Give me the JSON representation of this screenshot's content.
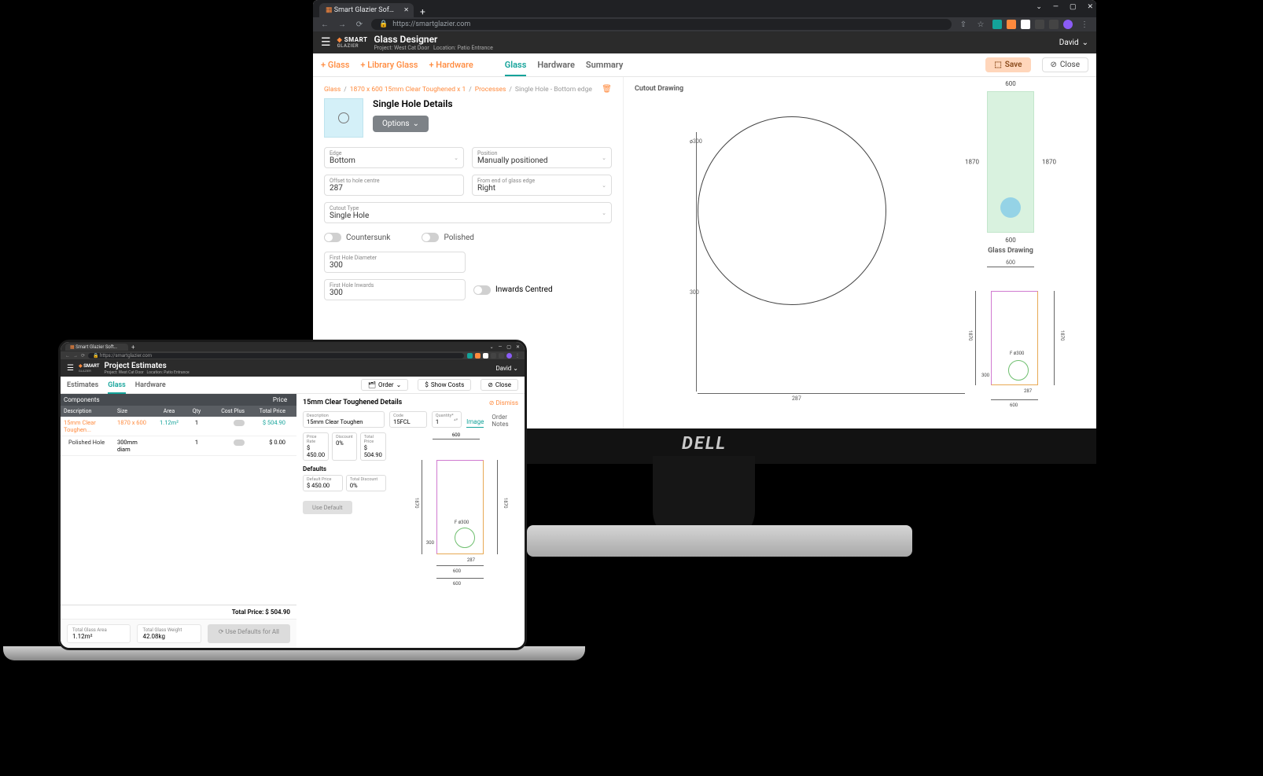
{
  "monitor": {
    "browser_tab": "Smart Glazier Software",
    "url": "https://smartglazier.com",
    "logo_a": "SMART",
    "logo_b": "GLAZIER",
    "title": "Glass Designer",
    "sub_project_lbl": "Project:",
    "sub_project": "West Cat Door",
    "sub_loc_lbl": "Location:",
    "sub_loc": "Patio Entrance",
    "user": "David",
    "toolbar": {
      "add_glass": "+ Glass",
      "add_lib": "+ Library Glass",
      "add_hw": "+ Hardware",
      "tab_glass": "Glass",
      "tab_hw": "Hardware",
      "tab_sum": "Summary",
      "save": "Save",
      "close": "Close"
    },
    "crumbs": {
      "c1": "Glass",
      "c2": "1870 x 600 15mm Clear Toughened x 1",
      "c3": "Processes",
      "c4": "Single Hole - Bottom edge"
    },
    "panel_title": "Single Hole Details",
    "options": "Options",
    "fields": {
      "edge_l": "Edge",
      "edge_v": "Bottom",
      "pos_l": "Position",
      "pos_v": "Manually positioned",
      "off_l": "Offset to hole centre",
      "off_v": "287",
      "from_l": "From end of glass edge",
      "from_v": "Right",
      "cut_l": "Cutout Type",
      "cut_v": "Single Hole",
      "csk": "Countersunk",
      "pol": "Polished",
      "d1_l": "First Hole Diameter",
      "d1_v": "300",
      "d2_l": "First Hole Inwards",
      "d2_v": "300",
      "inw": "Inwards Centred"
    },
    "drawings": {
      "cutout_title": "Cutout Drawing",
      "glass_title": "Glass Drawing",
      "d_300a": "ø300",
      "d_300": "300",
      "d_287": "287",
      "d_600": "600",
      "d_1870": "1870",
      "f300": "F ø300"
    }
  },
  "laptop": {
    "browser_tab": "Smart Glazier Software",
    "url": "https://smartglazier.com",
    "logo_a": "SMART",
    "logo_b": "GLAZIER",
    "title": "Project Estimates",
    "sub_project_lbl": "Project:",
    "sub_project": "West Cat Door",
    "sub_loc_lbl": "Location:",
    "sub_loc": "Patio Entrance",
    "user": "David",
    "tabs": {
      "est": "Estimates",
      "glass": "Glass",
      "hw": "Hardware"
    },
    "btns": {
      "order": "Order",
      "show": "Show Costs",
      "close": "Close"
    },
    "table": {
      "components": "Components",
      "price": "Price",
      "h_desc": "Description",
      "h_size": "Size",
      "h_area": "Area",
      "h_qty": "Qty",
      "h_cp": "Cost Plus",
      "h_tp": "Total Price",
      "r1_desc": "15mm Clear Toughen...",
      "r1_size": "1870 x 600",
      "r1_area": "1.12m²",
      "r1_qty": "1",
      "r1_tp": "$ 504.90",
      "r2_desc": "Polished Hole",
      "r2_size": "300mm diam",
      "r2_qty": "1",
      "r2_tp": "$ 0.00",
      "total": "Total Price: $ 504.90"
    },
    "footer": {
      "ga_l": "Total Glass Area",
      "ga_v": "1.12m²",
      "gw_l": "Total Glass Weight",
      "gw_v": "42.08kg",
      "usedef": "Use Defaults for All"
    },
    "right": {
      "title": "15mm Clear Toughened Details",
      "dismiss": "Dismiss",
      "desc_l": "Description",
      "desc_v": "15mm Clear Toughen",
      "code_l": "Code",
      "code_v": "15FCL",
      "qty_l": "Quantity*",
      "qty_v": "1",
      "tab_img": "Image",
      "tab_notes": "Order Notes",
      "pr_l": "Price Rate",
      "pr_v": "$ 450.00",
      "disc_l": "Discount",
      "disc_v": "0%",
      "tp_l": "Total Price",
      "tp_v": "$ 504.90",
      "defaults": "Defaults",
      "dp_l": "Default Price",
      "dp_v": "$ 450.00",
      "td_l": "Total Discount",
      "td_v": "0%",
      "use": "Use Default",
      "d_600": "600",
      "d_1870": "1870",
      "d_287": "287",
      "d_300": "300",
      "f300": "F ø300"
    }
  },
  "dell": "DELL"
}
